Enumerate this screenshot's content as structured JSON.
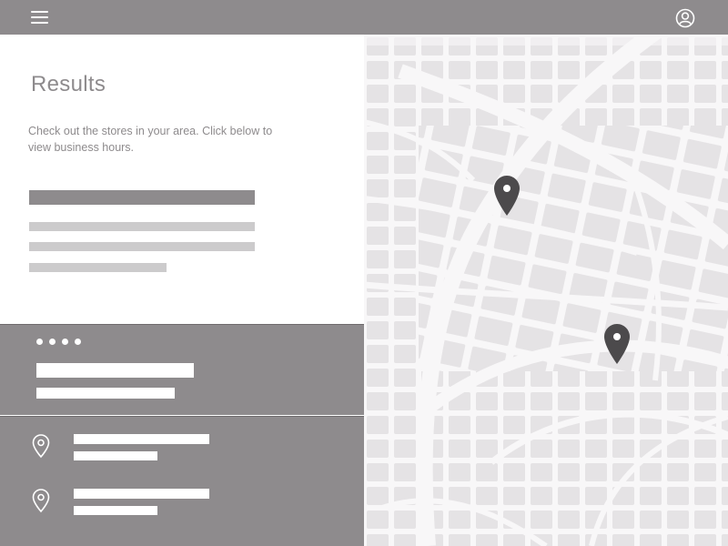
{
  "topbar": {
    "menu_icon": "hamburger-menu-icon",
    "profile_icon": "user-profile-icon"
  },
  "results": {
    "title": "Results",
    "description": "Check out the stores in your area. Click below to view business hours."
  },
  "carousel": {
    "page_count": 4
  },
  "store_list": {
    "item_count": 2,
    "item_icon": "location-pin-outline-icon"
  },
  "map": {
    "marker_count": 2,
    "marker_icon": "map-marker-icon"
  },
  "colors": {
    "bar_gray": "#8e8b8d",
    "placeholder_dark": "#8e8b8d",
    "placeholder_light": "#cccbcc",
    "map_block": "#e5e3e5",
    "map_street": "#f8f7f8",
    "marker": "#4c4a4c"
  }
}
